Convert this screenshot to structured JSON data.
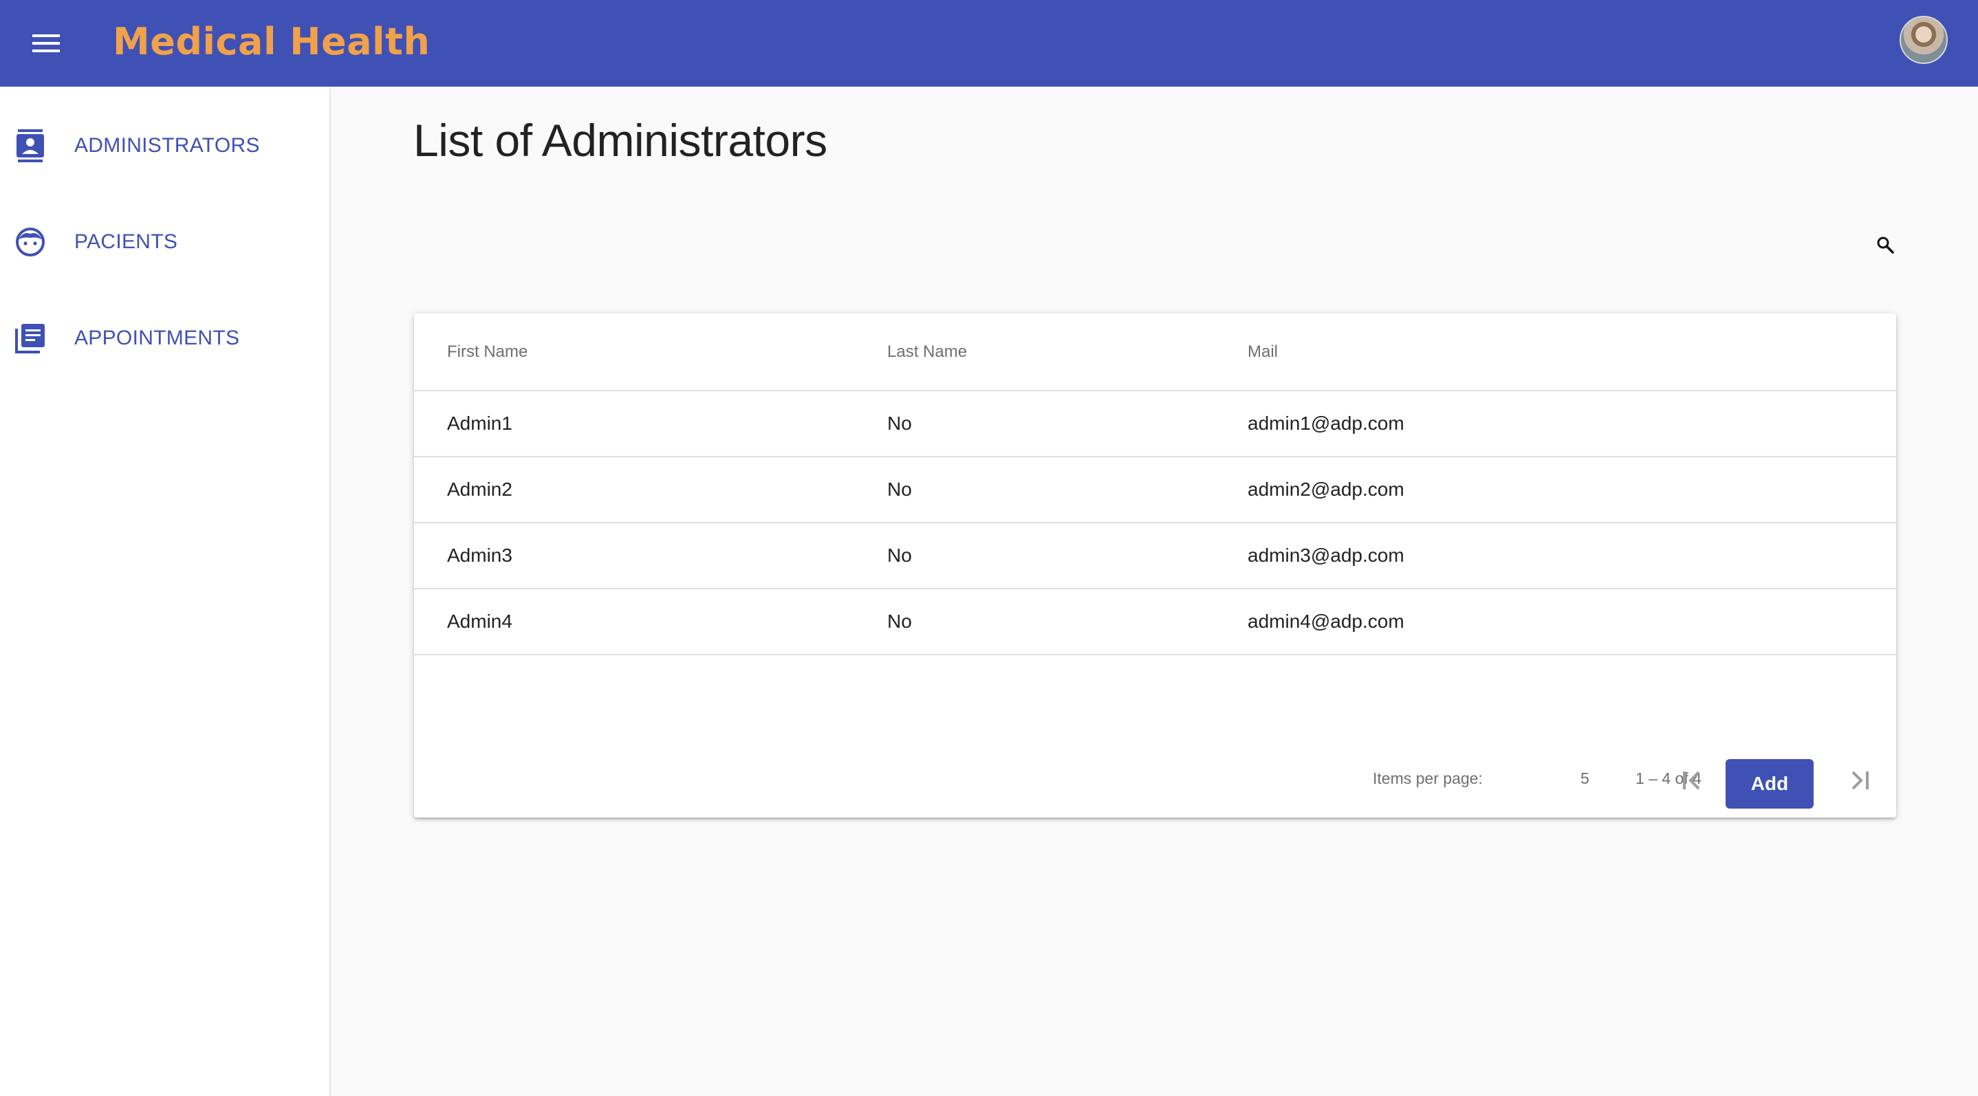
{
  "toolbar": {
    "title": "Medical Health",
    "title_color": "#f0a14a",
    "background": "#4051b5",
    "menu_icon": "menu-icon",
    "avatar": "user-avatar"
  },
  "sidenav": {
    "items": [
      {
        "label": "ADMINISTRATORS",
        "icon": "contact-card-icon"
      },
      {
        "label": "PACIENTS",
        "icon": "face-icon"
      },
      {
        "label": "APPOINTMENTS",
        "icon": "library-books-icon"
      }
    ]
  },
  "main": {
    "title": "List of Administrators",
    "search_icon": "search-icon",
    "table": {
      "columns": [
        "First Name",
        "Last Name",
        "Mail"
      ],
      "rows": [
        [
          "Admin1",
          "No",
          "admin1@adp.com"
        ],
        [
          "Admin2",
          "No",
          "admin2@adp.com"
        ],
        [
          "Admin3",
          "No",
          "admin3@adp.com"
        ],
        [
          "Admin4",
          "No",
          "admin4@adp.com"
        ]
      ]
    },
    "paginator": {
      "items_per_page_label": "Items per page:",
      "page_size": "5",
      "range_label": "1 – 4 of 4",
      "icons": [
        "first-page-icon",
        "previous-page-icon",
        "next-page-icon",
        "last-page-icon"
      ]
    },
    "add_label": "Add",
    "accent": "#3f51b5"
  }
}
